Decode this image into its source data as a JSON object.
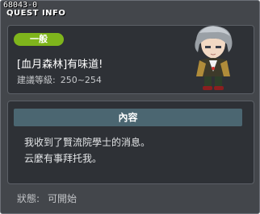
{
  "window": {
    "quest_id": "68043-0",
    "title": "QUEST INFO"
  },
  "quest": {
    "category_badge": "一般",
    "name": "[血月森林]有味道!",
    "level_label": "建議等級:",
    "level_range": "250~254"
  },
  "content": {
    "header": "內容",
    "lines": [
      "我收到了賢流院學士的消息。",
      "云麼有事拜托我。"
    ]
  },
  "status": {
    "label": "狀態:",
    "value": "可開始"
  },
  "colors": {
    "badge_green": "#7fb51c",
    "content_header": "#4b6671",
    "window_bg": "#43464b"
  }
}
